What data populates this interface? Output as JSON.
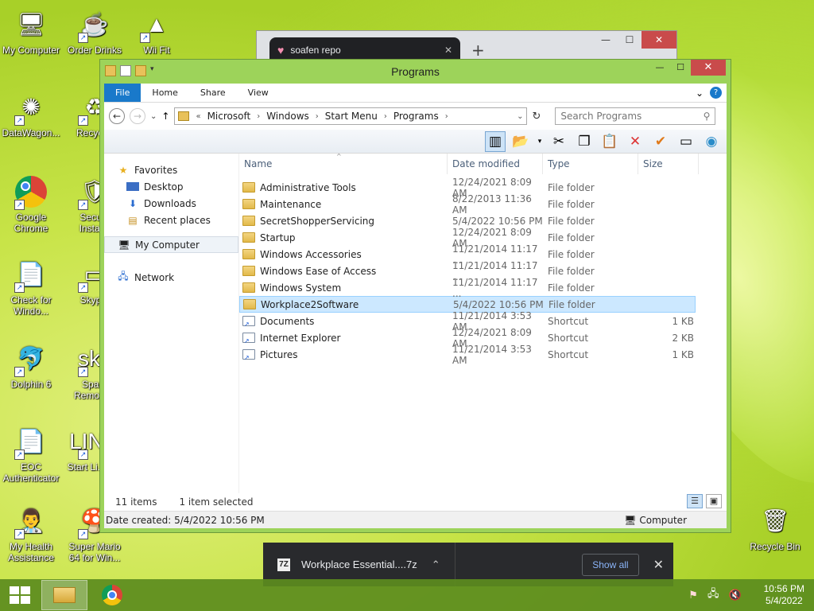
{
  "desktop": {
    "icons": [
      {
        "label": "My Computer",
        "glyph": "🖥"
      },
      {
        "label": "Order Drinks",
        "glyph": "☕"
      },
      {
        "label": "Wii Fit",
        "glyph": "▲"
      },
      {
        "label": "DataWagon...",
        "glyph": "✺"
      },
      {
        "label": "Recycl...",
        "glyph": "♻"
      },
      {
        "label": "Google Chrome",
        "glyph": ""
      },
      {
        "label": "Secu... Instal...",
        "glyph": "🛡"
      },
      {
        "label": "Check for Windo...",
        "glyph": "📄"
      },
      {
        "label": "Skyp...",
        "glyph": "▭"
      },
      {
        "label": "Dolphin 6",
        "glyph": "🐬"
      },
      {
        "label": "Spare Remote...",
        "glyph": "sky"
      },
      {
        "label": "EOC Authenticator",
        "glyph": "📄"
      },
      {
        "label": "Start Li... OS",
        "glyph": "LINU"
      },
      {
        "label": "My Health Assistance",
        "glyph": "👨‍⚕"
      },
      {
        "label": "Super Mario 64 for Win...",
        "glyph": "🍄"
      },
      {
        "label": "Recycle Bin",
        "glyph": "🗑"
      }
    ]
  },
  "chrome_window": {
    "tab_title": "soafen repo",
    "tab_close": "✕",
    "new_tab": "+",
    "min": "—",
    "max": "☐",
    "close": "✕"
  },
  "explorer": {
    "title": "Programs",
    "ctrl_min": "—",
    "ctrl_max": "☐",
    "ctrl_close": "✕",
    "ribbon_tabs": [
      "File",
      "Home",
      "Share",
      "View"
    ],
    "ribbon_collapse": "⌄",
    "help": "?",
    "address": {
      "overflow": "«",
      "segments": [
        "Microsoft",
        "Windows",
        "Start Menu",
        "Programs"
      ],
      "sep": "›",
      "dropdown": "⌄"
    },
    "search_placeholder": "Search Programs",
    "nav_back": "←",
    "nav_forward": "→",
    "nav_recent": "⌄",
    "nav_up": "↑",
    "refresh": "↻",
    "search_icon": "⚲",
    "navpane": {
      "favorites": "Favorites",
      "favorite_items": [
        "Desktop",
        "Downloads",
        "Recent places"
      ],
      "my_computer": "My Computer",
      "network": "Network"
    },
    "columns": {
      "name": "Name",
      "date": "Date modified",
      "type": "Type",
      "size": "Size",
      "sort_indicator": "^"
    },
    "files": [
      {
        "name": "Administrative Tools",
        "date": "12/24/2021 8:09 AM",
        "type": "File folder",
        "size": "",
        "kind": "folder"
      },
      {
        "name": "Maintenance",
        "date": "8/22/2013 11:36 AM",
        "type": "File folder",
        "size": "",
        "kind": "folder"
      },
      {
        "name": "SecretShopperServicing",
        "date": "5/4/2022 10:56 PM",
        "type": "File folder",
        "size": "",
        "kind": "folder"
      },
      {
        "name": "Startup",
        "date": "12/24/2021 8:09 AM",
        "type": "File folder",
        "size": "",
        "kind": "folder"
      },
      {
        "name": "Windows Accessories",
        "date": "11/21/2014 11:17 ...",
        "type": "File folder",
        "size": "",
        "kind": "folder"
      },
      {
        "name": "Windows Ease of Access",
        "date": "11/21/2014 11:17 ...",
        "type": "File folder",
        "size": "",
        "kind": "folder"
      },
      {
        "name": "Windows System",
        "date": "11/21/2014 11:17 ...",
        "type": "File folder",
        "size": "",
        "kind": "folder"
      },
      {
        "name": "Workplace2Software",
        "date": "5/4/2022 10:56 PM",
        "type": "File folder",
        "size": "",
        "kind": "folder",
        "selected": true
      },
      {
        "name": "Documents",
        "date": "11/21/2014 3:53 AM",
        "type": "Shortcut",
        "size": "1 KB",
        "kind": "shortcut"
      },
      {
        "name": "Internet Explorer",
        "date": "12/24/2021 8:09 AM",
        "type": "Shortcut",
        "size": "2 KB",
        "kind": "shortcut"
      },
      {
        "name": "Pictures",
        "date": "11/21/2014 3:53 AM",
        "type": "Shortcut",
        "size": "1 KB",
        "kind": "shortcut"
      }
    ],
    "status": {
      "count": "11 items",
      "selection": "1 item selected"
    },
    "details": {
      "date_created": "Date created: 5/4/2022 10:56 PM",
      "location": "Computer"
    }
  },
  "download_bar": {
    "file": "Workplace Essential....7z",
    "file_icon_label": "7Z",
    "chevron": "⌃",
    "show_all": "Show all",
    "close": "✕"
  },
  "taskbar": {
    "time": "10:56 PM",
    "date": "5/4/2022"
  },
  "colors": {
    "accent": "#1979ca",
    "window_frame": "#9dd35a",
    "selection": "#cce8ff"
  }
}
